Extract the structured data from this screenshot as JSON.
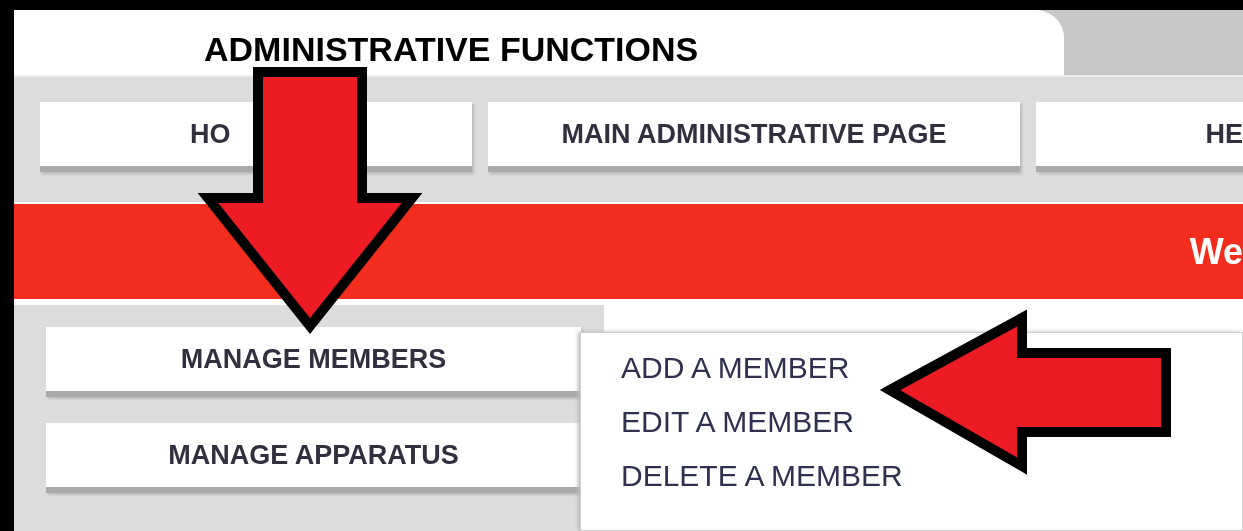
{
  "tab": {
    "title": "ADMINISTRATIVE FUNCTIONS"
  },
  "nav_buttons": [
    "HO",
    "MAIN ADMINISTRATIVE PAGE",
    "HE"
  ],
  "banner": {
    "text": "We"
  },
  "sidebar": {
    "buttons": [
      "MANAGE MEMBERS",
      "MANAGE APPARATUS"
    ]
  },
  "dropdown": {
    "items": [
      "ADD A MEMBER",
      "EDIT A MEMBER",
      "DELETE A MEMBER"
    ]
  }
}
